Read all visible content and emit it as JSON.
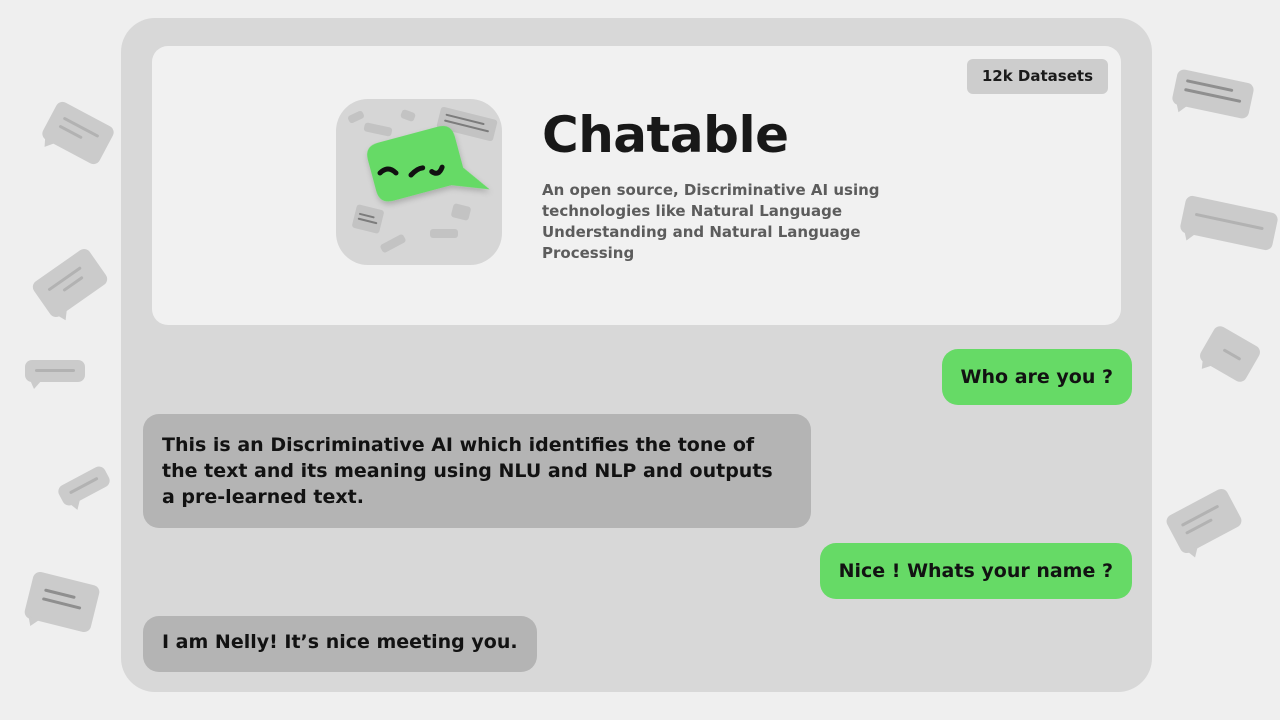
{
  "app": {
    "badge": "12k Datasets",
    "title": "Chatable",
    "description": "An open source, Discriminative AI using technologies like Natural Language Understanding and Natural Language Processing"
  },
  "colors": {
    "page_background": "#efefef",
    "panel_background": "#d8d8d8",
    "hero_background": "#f1f1f1",
    "user_bubble": "#66da66",
    "bot_bubble": "#b4b4b4",
    "badge_background": "#cdcdcd"
  },
  "icons": {
    "logo": "chat-bubble-smile-icon",
    "decoration": "chat-bubble-icon"
  },
  "chat": {
    "messages": [
      {
        "sender": "user",
        "text": "Who are you ?"
      },
      {
        "sender": "bot",
        "text": "This is an Discriminative AI which identifies the tone of the text and its meaning using NLU and NLP and outputs a pre-learned text."
      },
      {
        "sender": "user",
        "text": "Nice ! Whats your name ?"
      },
      {
        "sender": "bot",
        "text": "I am Nelly! It’s nice meeting you."
      }
    ]
  }
}
